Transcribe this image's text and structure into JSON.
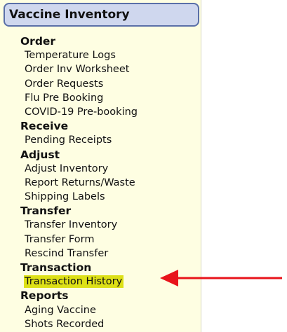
{
  "panel": {
    "title": "Vaccine Inventory"
  },
  "menu": [
    {
      "type": "section",
      "label": "Order",
      "name": "section-order"
    },
    {
      "type": "item",
      "label": "Temperature Logs",
      "name": "menu-item-temperature-logs"
    },
    {
      "type": "item",
      "label": "Order Inv Worksheet",
      "name": "menu-item-order-inv-worksheet"
    },
    {
      "type": "item",
      "label": "Order Requests",
      "name": "menu-item-order-requests"
    },
    {
      "type": "item",
      "label": "Flu Pre Booking",
      "name": "menu-item-flu-pre-booking"
    },
    {
      "type": "item",
      "label": "COVID-19 Pre-booking",
      "name": "menu-item-covid-19-pre-booking"
    },
    {
      "type": "section",
      "label": "Receive",
      "name": "section-receive"
    },
    {
      "type": "item",
      "label": "Pending Receipts",
      "name": "menu-item-pending-receipts"
    },
    {
      "type": "section",
      "label": "Adjust",
      "name": "section-adjust"
    },
    {
      "type": "item",
      "label": "Adjust Inventory",
      "name": "menu-item-adjust-inventory"
    },
    {
      "type": "item",
      "label": "Report Returns/Waste",
      "name": "menu-item-report-returns-waste"
    },
    {
      "type": "item",
      "label": "Shipping Labels",
      "name": "menu-item-shipping-labels"
    },
    {
      "type": "section",
      "label": "Transfer",
      "name": "section-transfer"
    },
    {
      "type": "item",
      "label": "Transfer Inventory",
      "name": "menu-item-transfer-inventory"
    },
    {
      "type": "item",
      "label": "Transfer Form",
      "name": "menu-item-transfer-form"
    },
    {
      "type": "item",
      "label": "Rescind Transfer",
      "name": "menu-item-rescind-transfer"
    },
    {
      "type": "section",
      "label": "Transaction",
      "name": "section-transaction"
    },
    {
      "type": "item",
      "label": "Transaction History",
      "name": "menu-item-transaction-history",
      "highlighted": true
    },
    {
      "type": "section",
      "label": "Reports",
      "name": "section-reports"
    },
    {
      "type": "item",
      "label": "Aging Vaccine",
      "name": "menu-item-aging-vaccine"
    },
    {
      "type": "item",
      "label": "Shots Recorded",
      "name": "menu-item-shots-recorded"
    }
  ],
  "colors": {
    "panel_background": "#fefee2",
    "header_background": "#cfd7ee",
    "header_border": "#5a6fa8",
    "highlight": "#dde017",
    "arrow": "#e8141b"
  },
  "annotation": {
    "icon": "arrow-left-icon",
    "points_to": "Transaction History"
  }
}
